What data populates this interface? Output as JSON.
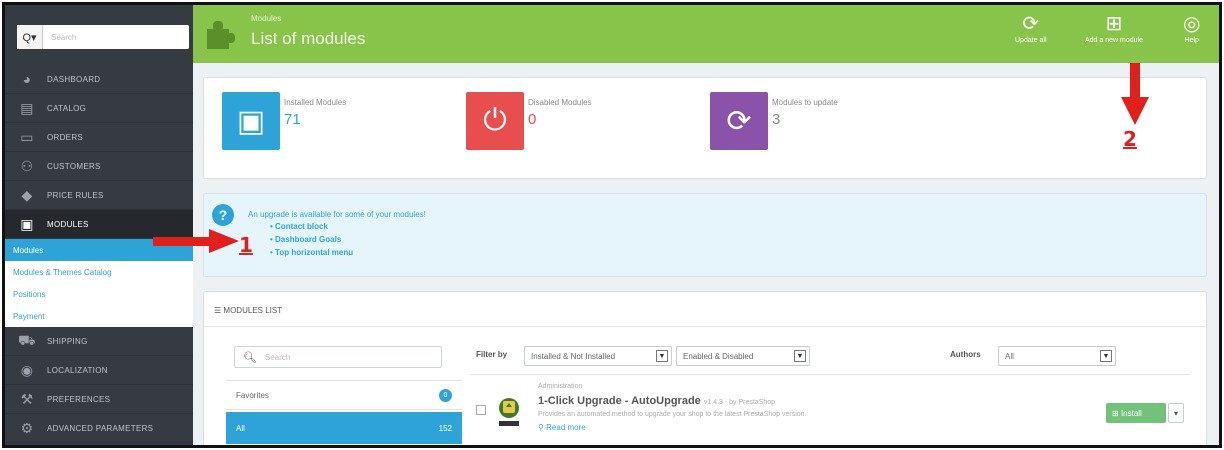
{
  "sidebar": {
    "search_button": "Q▾",
    "search_placeholder": "Search",
    "items": [
      {
        "label": "DASHBOARD",
        "icon": "dashboard-icon"
      },
      {
        "label": "CATALOG",
        "icon": "catalog-icon"
      },
      {
        "label": "ORDERS",
        "icon": "orders-icon"
      },
      {
        "label": "CUSTOMERS",
        "icon": "customers-icon"
      },
      {
        "label": "PRICE RULES",
        "icon": "price-rules-icon"
      },
      {
        "label": "MODULES",
        "icon": "modules-icon"
      },
      {
        "label": "SHIPPING",
        "icon": "shipping-icon"
      },
      {
        "label": "LOCALIZATION",
        "icon": "localization-icon"
      },
      {
        "label": "PREFERENCES",
        "icon": "preferences-icon"
      },
      {
        "label": "ADVANCED PARAMETERS",
        "icon": "advanced-parameters-icon"
      }
    ],
    "submenu": [
      {
        "label": "Modules"
      },
      {
        "label": "Modules & Themes Catalog"
      },
      {
        "label": "Positions"
      },
      {
        "label": "Payment"
      }
    ]
  },
  "header": {
    "breadcrumb": "Modules",
    "title": "List of modules",
    "toolbar": {
      "update_all": "Update all",
      "add_new_module": "Add a new module",
      "help": "Help"
    }
  },
  "kpis": [
    {
      "label": "Installed Modules",
      "value": "71",
      "color": "#2ea3d8",
      "value_color": "#2ea3d8"
    },
    {
      "label": "Disabled Modules",
      "value": "0",
      "color": "#e84e4e",
      "value_color": "#e84e4e"
    },
    {
      "label": "Modules to update",
      "value": "3",
      "color": "#8a52a8",
      "value_color": "#888888"
    }
  ],
  "notice": {
    "message": "An upgrade is available for some of your modules!",
    "modules": [
      "Contact block",
      "Dashboard Goals",
      "Top horizontal menu"
    ]
  },
  "modules_list": {
    "heading": "MODULES LIST",
    "search_placeholder": "Search",
    "favorites_label": "Favorites",
    "favorites_count": "0",
    "all_label": "All",
    "all_count": "152",
    "filter_label": "Filter by",
    "filter_install": "Installed & Not Installed",
    "filter_enabled": "Enabled & Disabled",
    "authors_label": "Authors",
    "authors_value": "All",
    "row": {
      "category": "Administration",
      "name": "1-Click Upgrade - AutoUpgrade",
      "version": "v1.4.3 - by PrestaShop",
      "description": "Provides an automated method to upgrade your shop to the latest PrestaShop version.",
      "read_more": "Read more",
      "install_label": "Install"
    }
  },
  "annotations": {
    "one": "1",
    "two": "2",
    "color": "#e0201c"
  },
  "colors": {
    "header_green": "#88c34a",
    "sidebar_dark": "#363a41",
    "accent_blue": "#2ea3d8"
  }
}
